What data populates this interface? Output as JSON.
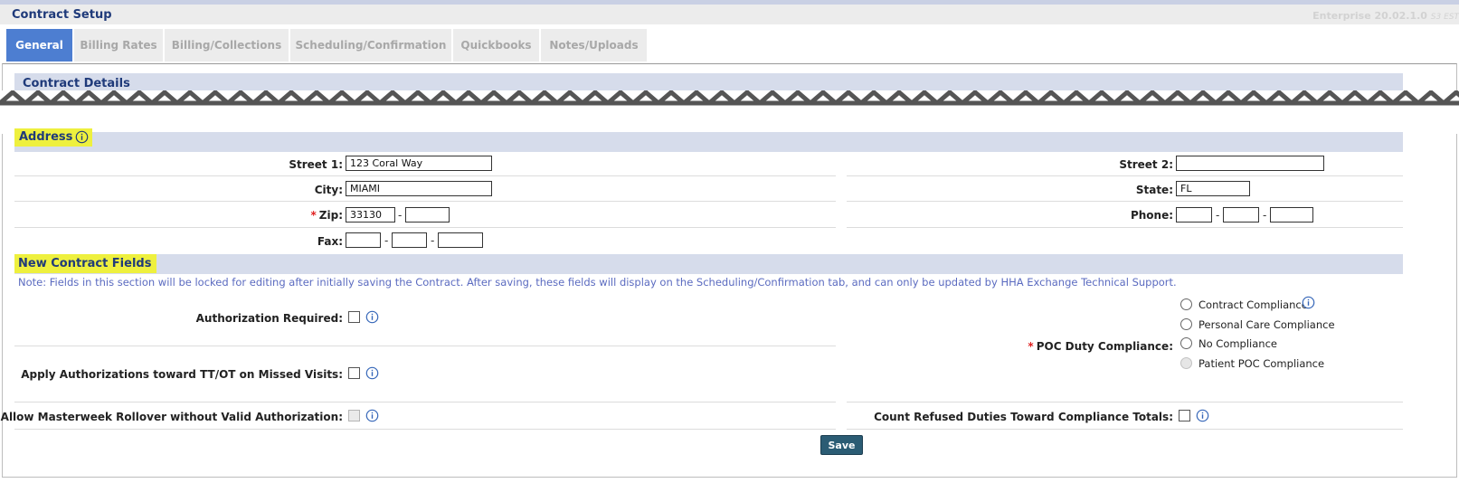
{
  "header": {
    "title": "Contract Setup",
    "version": "Enterprise 20.02.1.0",
    "version_suffix": "S3 EST"
  },
  "tabs": [
    {
      "label": "General",
      "active": true
    },
    {
      "label": "Billing Rates",
      "active": false
    },
    {
      "label": "Billing/Collections",
      "active": false
    },
    {
      "label": "Scheduling/Confirmation",
      "active": false
    },
    {
      "label": "Quickbooks",
      "active": false
    },
    {
      "label": "Notes/Uploads",
      "active": false
    }
  ],
  "contract_details": {
    "title": "Contract Details"
  },
  "address": {
    "title": "Address",
    "street1_label": "Street 1:",
    "street1_value": "123 Coral Way",
    "street2_label": "Street 2:",
    "street2_value": "",
    "city_label": "City:",
    "city_value": "MIAMI",
    "state_label": "State:",
    "state_value": "FL",
    "zip_label": "Zip:",
    "zip_value": "33130",
    "zip_ext_value": "",
    "phone_label": "Phone:",
    "fax_label": "Fax:",
    "required_mark": "*",
    "dash": "-"
  },
  "new_contract_fields": {
    "title": "New Contract Fields",
    "note": "Note: Fields in this section will be locked for editing after initially saving the Contract. After saving, these fields will display on the Scheduling/Confirmation tab, and can only be updated by HHA Exchange Technical Support.",
    "authorization_required_label": "Authorization Required:",
    "apply_authorizations_label": "Apply Authorizations toward TT/OT on Missed Visits:",
    "allow_masterweek_label": "Allow Masterweek Rollover without Valid Authorization:",
    "poc_duty_label": "POC Duty Compliance:",
    "poc_options": [
      {
        "label": "Contract Compliance",
        "disabled": false
      },
      {
        "label": "Personal Care Compliance",
        "disabled": false
      },
      {
        "label": "No Compliance",
        "disabled": false
      },
      {
        "label": "Patient POC Compliance",
        "disabled": true
      }
    ],
    "count_refused_label": "Count Refused Duties Toward Compliance Totals:"
  },
  "actions": {
    "save_label": "Save"
  },
  "colors": {
    "accent": "#4d7ed1",
    "highlight": "#eef03e",
    "section_bg": "#d6dceb",
    "heading": "#1f3a7a",
    "note": "#5b6bc0",
    "required": "#e02020",
    "save_button": "#2b5c74"
  },
  "icons": {
    "info": "info-circle-icon",
    "radio": "radio-button",
    "checkbox": "checkbox"
  }
}
